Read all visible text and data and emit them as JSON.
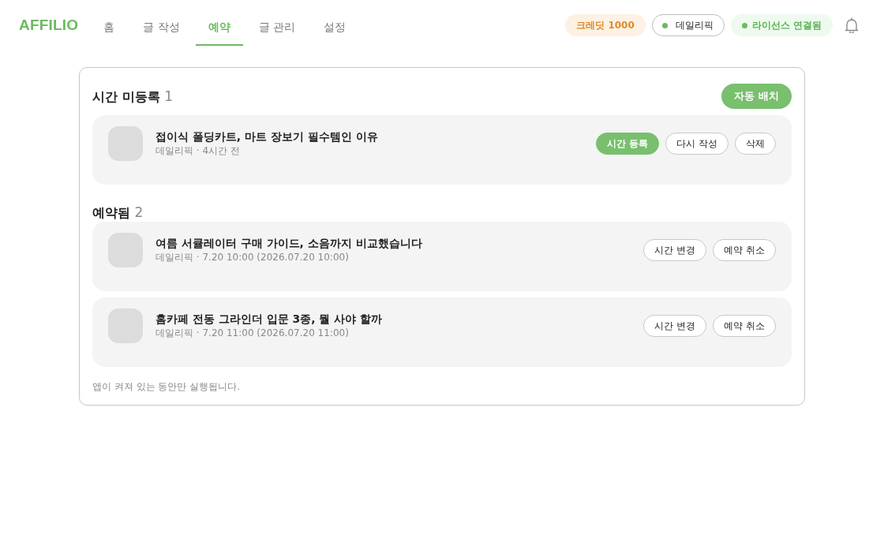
{
  "app": {
    "logo": "AFFILIO"
  },
  "nav_tabs": [
    {
      "label": "홈",
      "selected": false
    },
    {
      "label": "글 작성",
      "selected": false
    },
    {
      "label": "예약",
      "selected": true
    },
    {
      "label": "글 관리",
      "selected": false
    },
    {
      "label": "설정",
      "selected": false
    }
  ],
  "header_badges": [
    {
      "kind": "credit",
      "label": "크레딧 1000"
    },
    {
      "kind": "account",
      "label": "데일리픽"
    },
    {
      "kind": "license",
      "label": "라이선스 연결됨"
    }
  ],
  "sections": [
    {
      "title": "시간 미등록",
      "count": "1",
      "action": {
        "label": "자동 배치"
      },
      "posts": [
        {
          "title": "접이식 폴딩카트, 마트 장보기 필수템인 이유",
          "meta": "데일리픽 · 4시간 전",
          "buttons": [
            {
              "label": "시간 등록",
              "kind": "primary"
            },
            {
              "label": "다시 작성",
              "kind": "outline"
            },
            {
              "label": "삭제",
              "kind": "outline"
            }
          ]
        }
      ]
    },
    {
      "title": "예약됨",
      "count": "2",
      "posts": [
        {
          "title": "여름 서큘레이터 구매 가이드, 소음까지 비교했습니다",
          "meta": "데일리픽 · 7.20 10:00 (2026.07.20 10:00)",
          "buttons": [
            {
              "label": "시간 변경",
              "kind": "outline"
            },
            {
              "label": "예약 취소",
              "kind": "outline"
            }
          ]
        },
        {
          "title": "홈카페 전동 그라인더 입문 3종, 뭘 사야 할까",
          "meta": "데일리픽 · 7.20 11:00 (2026.07.20 11:00)",
          "buttons": [
            {
              "label": "시간 변경",
              "kind": "outline"
            },
            {
              "label": "예약 취소",
              "kind": "outline"
            }
          ]
        }
      ]
    }
  ],
  "footer_note": "앱이 켜져 있는 동안만 실행됩니다."
}
